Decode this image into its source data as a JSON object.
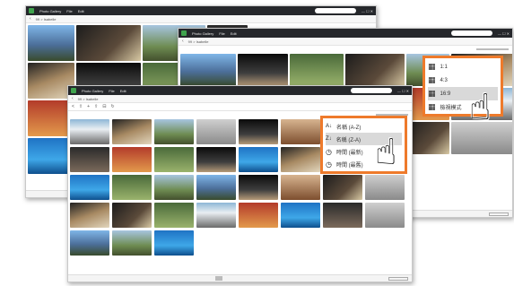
{
  "windows": [
    {
      "title": "Photo Gallery",
      "menu": [
        "File",
        "Edit"
      ],
      "path": "99 > Isabelle"
    },
    {
      "title": "Photo Gallery",
      "menu": [
        "File",
        "Edit"
      ],
      "path": "99 > Isabelle"
    },
    {
      "title": "Photo Gallery",
      "menu": [
        "File",
        "Edit"
      ],
      "path": "99 > Isabelle"
    }
  ],
  "toolbar_icons": [
    "back-icon",
    "forward-icon",
    "upload-icon",
    "download-icon",
    "share-icon",
    "delete-icon",
    "refresh-icon"
  ],
  "aspect_menu": {
    "items": [
      {
        "label": "1:1",
        "icon": "square-grid-icon",
        "selected": false
      },
      {
        "label": "4:3",
        "icon": "square-grid-icon",
        "selected": false
      },
      {
        "label": "16:9",
        "icon": "square-grid-icon",
        "selected": true
      },
      {
        "label": "檢視模式",
        "icon": "square-grid-icon",
        "selected": false
      }
    ]
  },
  "sort_menu": {
    "items": [
      {
        "label": "名稱 (A-Z)",
        "icon": "sort-az-icon",
        "selected": false
      },
      {
        "label": "名稱 (Z-A)",
        "icon": "sort-za-icon",
        "selected": true
      },
      {
        "label": "時間 (最新)",
        "icon": "clock-icon",
        "selected": false
      },
      {
        "label": "時間 (最舊)",
        "icon": "clock-icon",
        "selected": false
      }
    ]
  },
  "colors": {
    "accent": "#ee7a2b",
    "titlebar": "#25272b"
  }
}
